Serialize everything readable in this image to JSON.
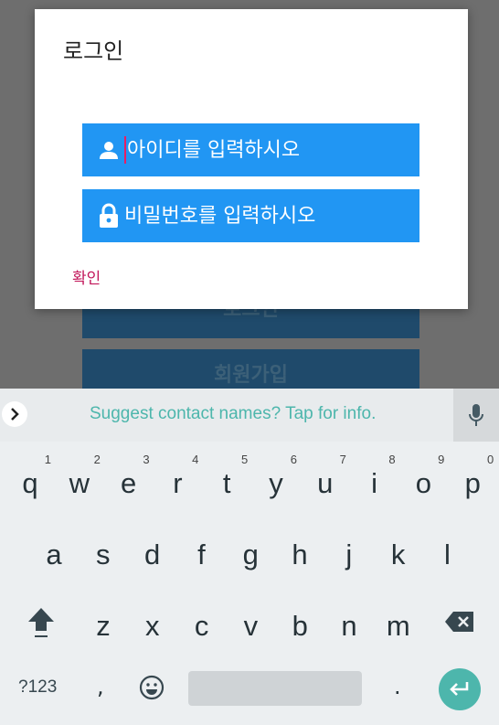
{
  "background": {
    "login_button": "로그인",
    "signup_button": "회원가입"
  },
  "dialog": {
    "title": "로그인",
    "id_placeholder": "아이디를 입력하시오",
    "pw_placeholder": "비밀번호를 입력하시오",
    "confirm_label": "확인"
  },
  "keyboard": {
    "suggestion": "Suggest contact names? Tap for info.",
    "row1": [
      {
        "ch": "q",
        "hint": "1"
      },
      {
        "ch": "w",
        "hint": "2"
      },
      {
        "ch": "e",
        "hint": "3"
      },
      {
        "ch": "r",
        "hint": "4"
      },
      {
        "ch": "t",
        "hint": "5"
      },
      {
        "ch": "y",
        "hint": "6"
      },
      {
        "ch": "u",
        "hint": "7"
      },
      {
        "ch": "i",
        "hint": "8"
      },
      {
        "ch": "o",
        "hint": "9"
      },
      {
        "ch": "p",
        "hint": "0"
      }
    ],
    "row2": [
      "a",
      "s",
      "d",
      "f",
      "g",
      "h",
      "j",
      "k",
      "l"
    ],
    "row3": [
      "z",
      "x",
      "c",
      "v",
      "b",
      "n",
      "m"
    ],
    "symbols_label": "?123",
    "comma": ",",
    "period": "."
  },
  "icons": {
    "id_field": "person-icon",
    "pw_field": "lock-icon",
    "suggest_arrow": "chevron-right-icon",
    "mic": "microphone-icon",
    "shift": "shift-icon",
    "backspace": "backspace-icon",
    "emoji": "emoji-icon",
    "enter": "enter-icon"
  },
  "colors": {
    "field_blue": "#2196f3",
    "confirm_pink": "#c2185b",
    "accent_teal": "#4db6ac"
  }
}
